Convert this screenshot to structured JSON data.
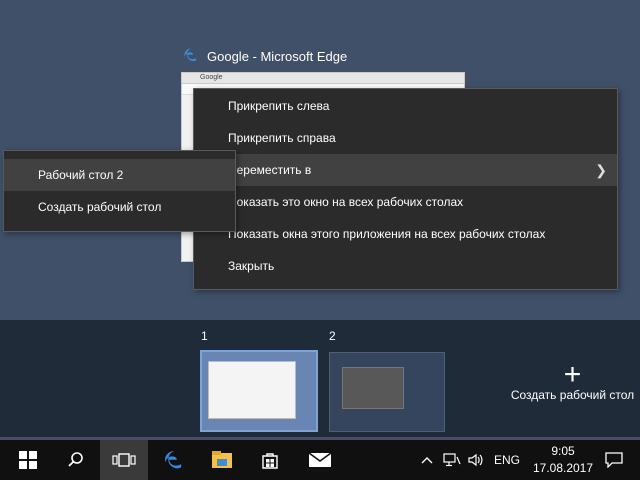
{
  "window": {
    "title": "Google - Microsoft Edge",
    "tab_text": "Google"
  },
  "context_menu": {
    "items": [
      {
        "label": "Прикрепить слева"
      },
      {
        "label": "Прикрепить справа"
      },
      {
        "label": "Переместить в",
        "has_submenu": true
      },
      {
        "label": "Показать это окно на всех рабочих столах"
      },
      {
        "label": "Показать окна этого приложения на всех рабочих столах"
      },
      {
        "label": "Закрыть"
      }
    ]
  },
  "submenu": {
    "items": [
      {
        "label": "Рабочий стол 2"
      },
      {
        "label": "Создать рабочий стол"
      }
    ]
  },
  "desktops": [
    {
      "number": "1"
    },
    {
      "number": "2"
    }
  ],
  "new_desktop": {
    "label": "Создать рабочий стол",
    "icon": "plus-icon"
  },
  "taskbar": {
    "buttons": [
      "windows-start-icon",
      "search-icon",
      "task-view-icon",
      "edge-icon",
      "file-explorer-icon",
      "store-icon",
      "mail-icon"
    ],
    "tray": {
      "language": "ENG",
      "time": "9:05",
      "date": "17.08.2017"
    }
  },
  "colors": {
    "accent": "#0078d7",
    "menu_bg": "#2b2b2b",
    "taskbar_bg": "#101010"
  }
}
